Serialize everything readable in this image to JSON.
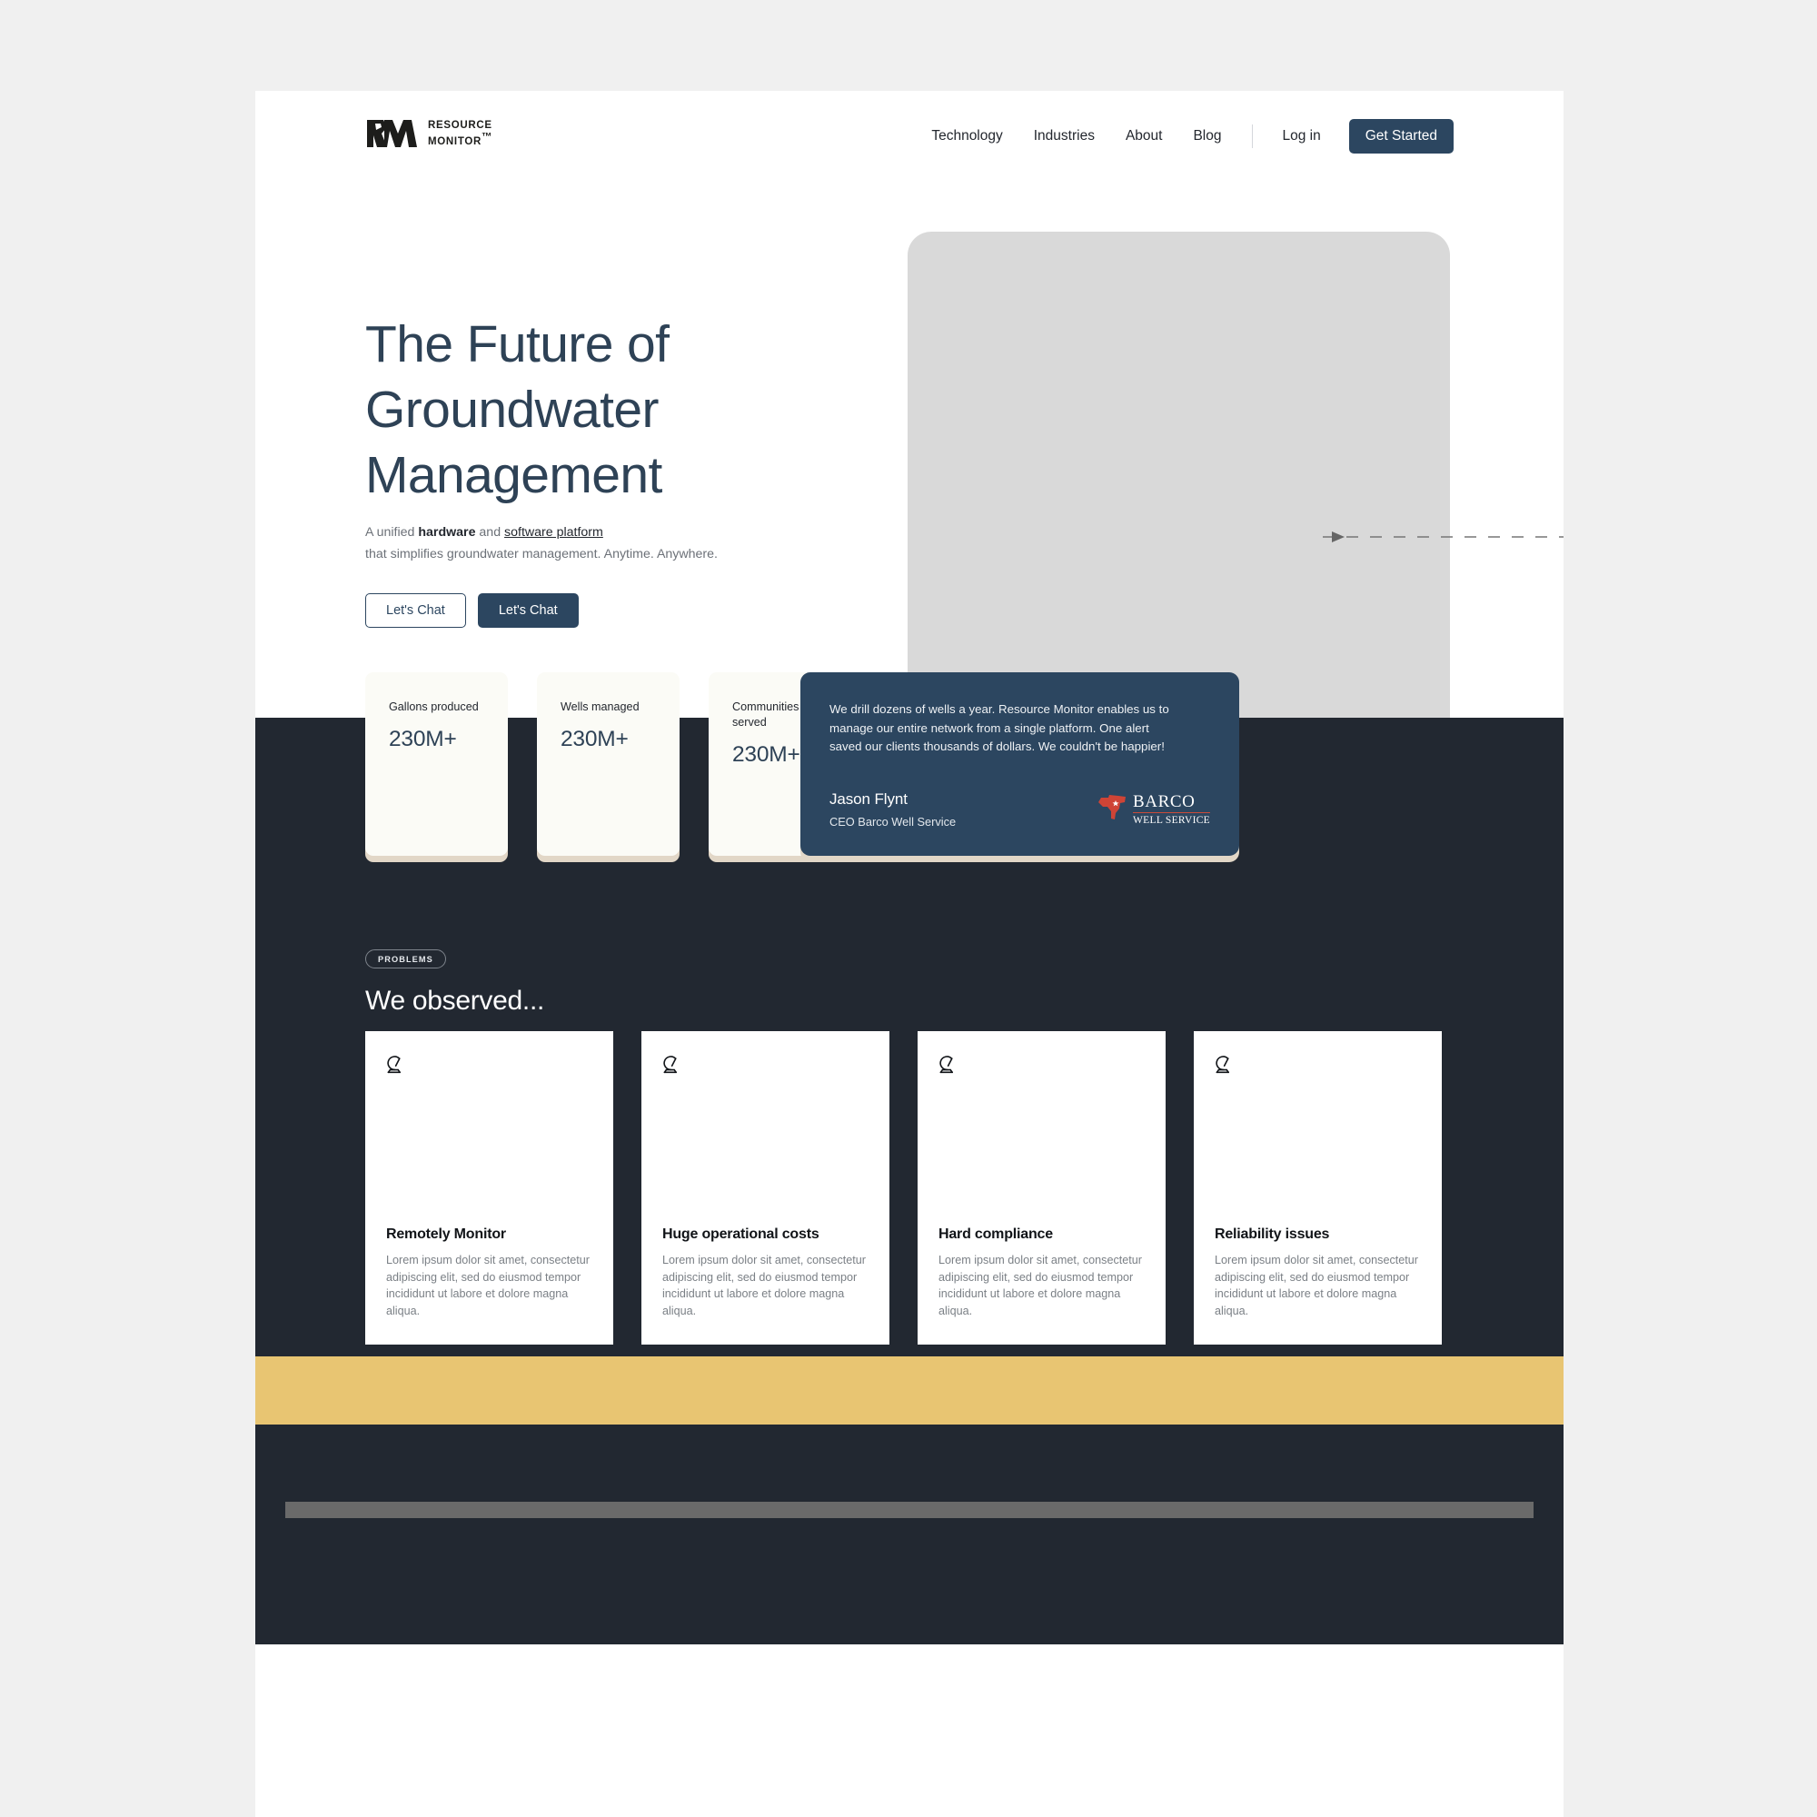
{
  "brand": {
    "logo_mark": "rm-monogram-icon",
    "name_line1": "RESOURCE",
    "name_line2": "MONITOR",
    "trademark": "™"
  },
  "nav": {
    "links": [
      {
        "label": "Technology",
        "name": "nav-link-technology"
      },
      {
        "label": "Industries",
        "name": "nav-link-industries"
      },
      {
        "label": "About",
        "name": "nav-link-about"
      },
      {
        "label": "Blog",
        "name": "nav-link-blog"
      }
    ],
    "login_label": "Log in",
    "cta_label": "Get Started"
  },
  "hero": {
    "title_line1": "The Future of",
    "title_line2": "Groundwater",
    "title_line3": "Management",
    "sub_prefix": "A unified ",
    "sub_bold": "hardware",
    "sub_mid": " and ",
    "sub_link": "software platform",
    "sub_line2": "that simplifies groundwater management. Anytime. Anywhere.",
    "btn_outline_label": "Let's Chat",
    "btn_solid_label": "Let's Chat",
    "media_placeholder": "hero-image-placeholder",
    "arrow": "dashed-arrow-right-icon"
  },
  "stats": [
    {
      "label": "Gallons produced",
      "value": "230M+"
    },
    {
      "label": "Wells managed",
      "value": "230M+"
    },
    {
      "label": "Communities served",
      "value": "230M+"
    }
  ],
  "testimonial": {
    "quote": "We drill dozens of wells a year. Resource Monitor enables us to manage our entire network from a single platform. One alert saved our clients thousands of dollars. We couldn't be happier!",
    "author": "Jason Flynt",
    "role": "CEO Barco Well Service",
    "company_logo_top": "BARCO",
    "company_logo_bottom": "WELL SERVICE",
    "company_logo_icon": "texas-state-icon"
  },
  "problems": {
    "badge": "PROBLEMS",
    "title": "We observed...",
    "cards": [
      {
        "icon": "satellite-dish-icon",
        "title": "Remotely Monitor",
        "body": "Lorem ipsum dolor sit amet, consectetur adipiscing elit, sed do eiusmod tempor incididunt ut labore et dolore magna aliqua."
      },
      {
        "icon": "satellite-dish-icon",
        "title": "Huge operational costs",
        "body": "Lorem ipsum dolor sit amet, consectetur adipiscing elit, sed do eiusmod tempor incididunt ut labore et dolore magna aliqua."
      },
      {
        "icon": "satellite-dish-icon",
        "title": "Hard compliance",
        "body": "Lorem ipsum dolor sit amet, consectetur adipiscing elit, sed do eiusmod tempor incididunt ut labore et dolore magna aliqua."
      },
      {
        "icon": "satellite-dish-icon",
        "title": "Reliability issues",
        "body": "Lorem ipsum dolor sit amet, consectetur adipiscing elit, sed do eiusmod tempor incididunt ut labore et dolore magna aliqua."
      }
    ]
  },
  "colors": {
    "page_backdrop": "#f0f0f0",
    "navy": "#2c4660",
    "dark_section": "#222831",
    "cream_card": "#fbfbf6",
    "card_shadow": "#e2d7c7",
    "yellow_band": "#e8c572",
    "grey_bar": "#6a6a6a",
    "media_placeholder": "#d9d9d9",
    "barco_red": "#c94b3a"
  }
}
